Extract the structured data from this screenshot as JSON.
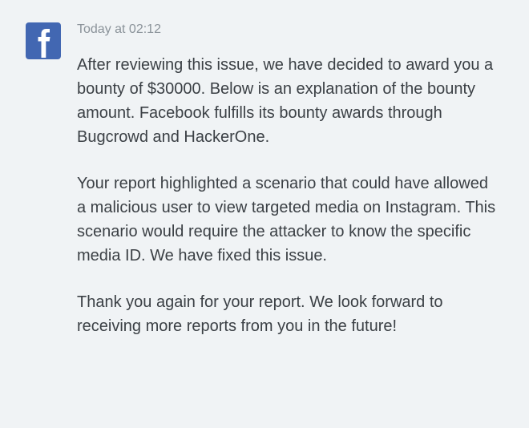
{
  "message": {
    "timestamp": "Today at 02:12",
    "sender_icon": "facebook-logo",
    "paragraphs": [
      "After reviewing this issue, we have decided to award you a bounty of $30000. Below is an explanation of the bounty amount. Facebook fulfills its bounty awards through Bugcrowd and HackerOne.",
      "Your report highlighted a scenario that could have allowed a malicious user to view targeted media on Instagram. This scenario would require the attacker to know the specific media ID. We have fixed this issue.",
      "Thank you again for your report. We look forward to receiving more reports from you in the future!"
    ]
  }
}
